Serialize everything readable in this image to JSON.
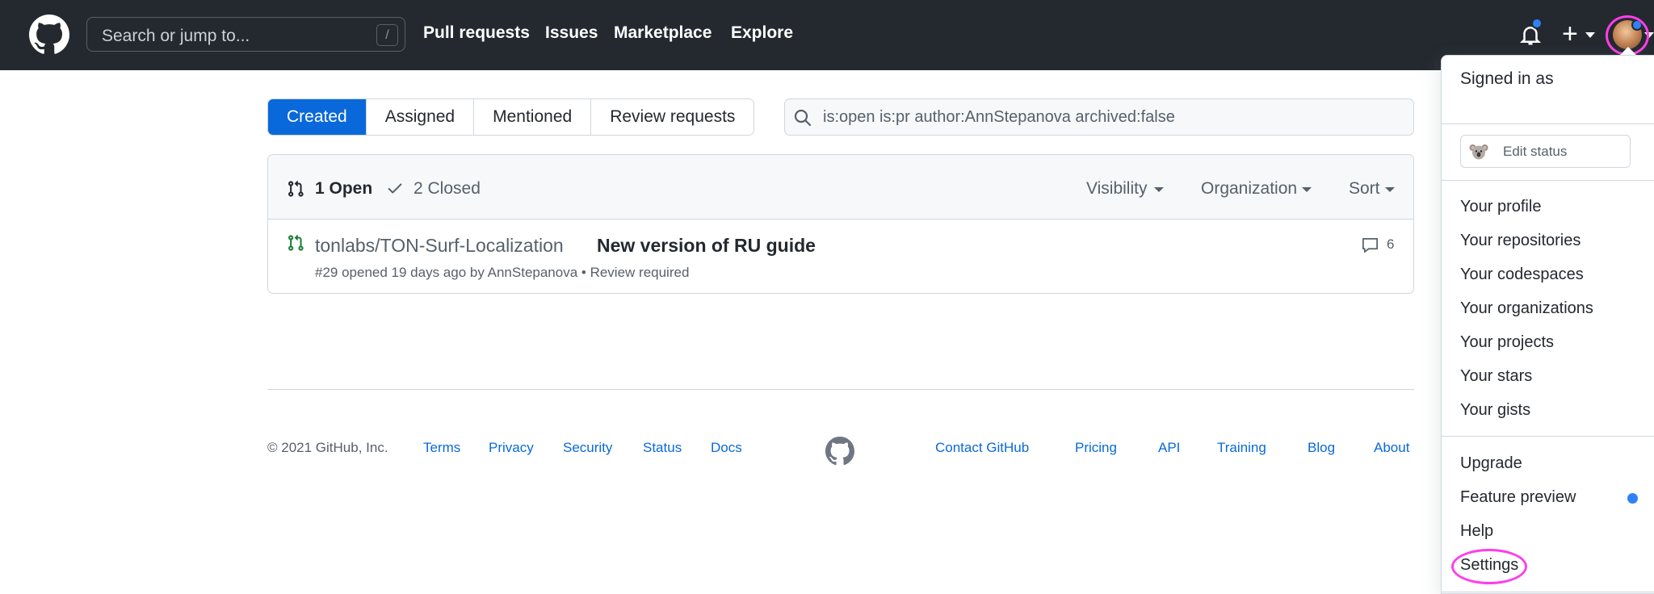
{
  "header": {
    "search_placeholder": "Search or jump to...",
    "search_shortcut": "/",
    "nav": [
      "Pull requests",
      "Issues",
      "Marketplace",
      "Explore"
    ],
    "plus": "+"
  },
  "tabs": [
    "Created",
    "Assigned",
    "Mentioned",
    "Review requests"
  ],
  "filter_query": "is:open is:pr author:AnnStepanova archived:false",
  "list_header": {
    "open": "1 Open",
    "closed": "2 Closed",
    "visibility": "Visibility",
    "organization": "Organization",
    "sort": "Sort"
  },
  "pull_request": {
    "repo": "tonlabs/TON-Surf-Localization",
    "title": "New version of RU guide",
    "meta": "#29 opened 19 days ago by AnnStepanova • Review required",
    "comments": "6"
  },
  "footer": {
    "copyright": "© 2021 GitHub, Inc.",
    "left_links": [
      "Terms",
      "Privacy",
      "Security",
      "Status",
      "Docs"
    ],
    "right_links": [
      "Contact GitHub",
      "Pricing",
      "API",
      "Training",
      "Blog",
      "About"
    ]
  },
  "user_menu": {
    "signed_in": "Signed in as",
    "edit_status": "Edit status",
    "group1": [
      "Your profile",
      "Your repositories",
      "Your codespaces",
      "Your organizations",
      "Your projects",
      "Your stars",
      "Your gists"
    ],
    "group2": [
      "Upgrade",
      "Feature preview",
      "Help",
      "Settings"
    ]
  },
  "colors": {
    "header_bg": "#24292f",
    "accent": "#0969da",
    "open_green": "#1a7f37",
    "highlight": "#ff3ee8",
    "notification": "#2f81f7"
  },
  "icons": [
    "github-logo",
    "bell-icon",
    "plus-icon",
    "search-icon",
    "pull-request-icon",
    "check-icon",
    "comment-icon"
  ]
}
